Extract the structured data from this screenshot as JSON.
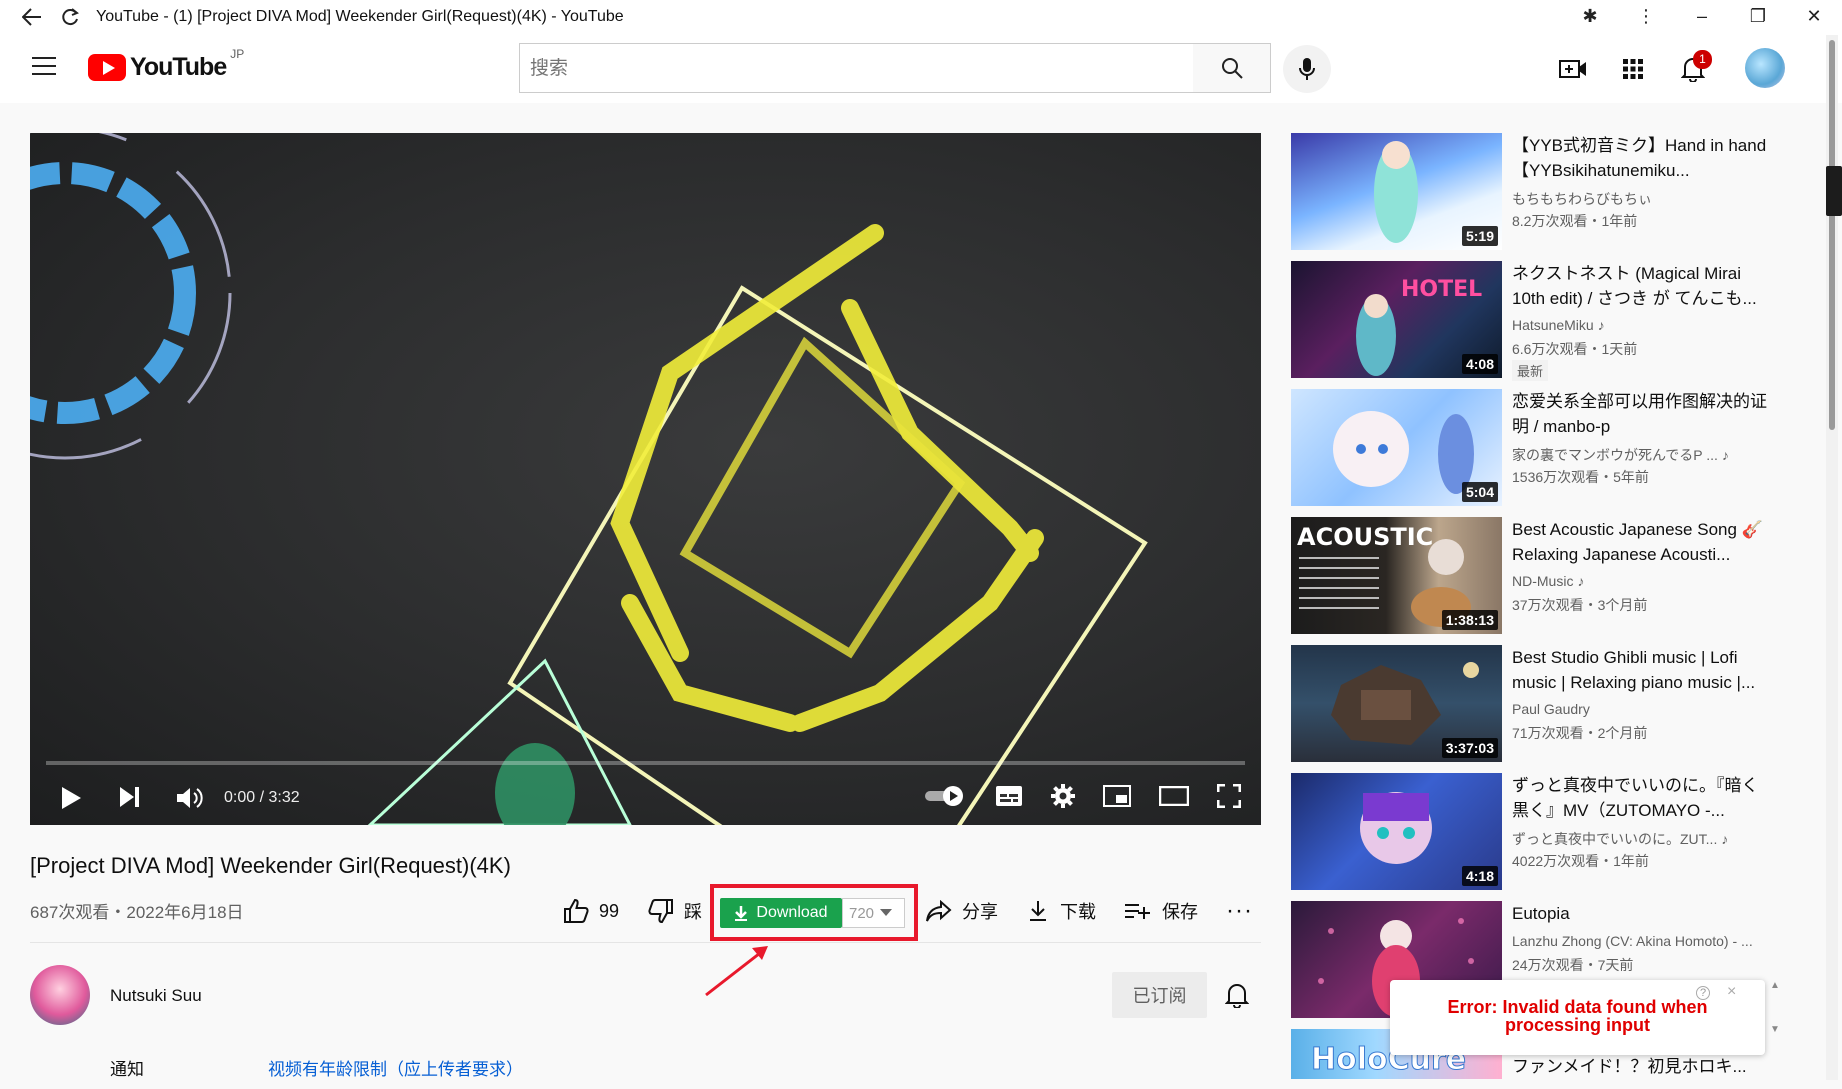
{
  "window": {
    "title": "YouTube - (1) [Project DIVA Mod] Weekender Girl(Request)(4K) - YouTube"
  },
  "masthead": {
    "region": "JP",
    "search_placeholder": "搜索",
    "notification_count": "1"
  },
  "player": {
    "time": "0:00 / 3:32",
    "played_fraction": 0.0
  },
  "video": {
    "title": "[Project DIVA Mod] Weekender Girl(Request)(4K)",
    "views_date": "687次观看・2022年6月18日",
    "like_count": "99",
    "dislike_label": "踩",
    "download_label": "Download",
    "quality": "720",
    "share_label": "分享",
    "save_offline_label": "下载",
    "save_label": "保存"
  },
  "channel": {
    "name": "Nutsuki Suu",
    "subscribe_label": "已订阅"
  },
  "description": {
    "notice_label": "通知",
    "notice_link": "视频有年龄限制（应上传者要求）"
  },
  "recommendations": [
    {
      "title": "【YYB式初音ミク】Hand in hand　【YYBsikihatunemiku...",
      "channel": "もちもちわらびもちぃ",
      "meta": "8.2万次观看・1年前",
      "duration": "5:19"
    },
    {
      "title": "ネクストネスト (Magical Mirai 10th edit) / さつき が てんこも...",
      "channel": "HatsuneMiku ♪",
      "meta": "6.6万次观看・1天前",
      "duration": "4:08",
      "badge": "最新"
    },
    {
      "title": "恋爱关系全部可以用作图解决的证明 / manbo-p",
      "channel": "家の裏でマンボウが死んでるP ... ♪",
      "meta": "1536万次观看・5年前",
      "duration": "5:04"
    },
    {
      "title": "Best Acoustic Japanese Song 🎸 Relaxing Japanese Acousti...",
      "channel": "ND-Music ♪",
      "meta": "37万次观看・3个月前",
      "duration": "1:38:13"
    },
    {
      "title": "Best Studio Ghibli music | Lofi music | Relaxing piano music |...",
      "channel": "Paul Gaudry",
      "meta": "71万次观看・2个月前",
      "duration": "3:37:03"
    },
    {
      "title": "ずっと真夜中でいいのに。『暗く黒く』MV（ZUTOMAYO -...",
      "channel": "ずっと真夜中でいいのに。ZUT... ♪",
      "meta": "4022万次观看・1年前",
      "duration": "4:18"
    },
    {
      "title": "Eutopia",
      "channel": "Lanzhu Zhong (CV: Akina Homoto) - ...",
      "meta": "24万次观看・7天前",
      "duration": ""
    },
    {
      "title": "ファンメイド！？初見ホロキ...",
      "channel": "",
      "meta": "",
      "duration": ""
    }
  ],
  "error_popup": {
    "line1": "Error:  Invalid data found when",
    "line2": "processing input"
  }
}
